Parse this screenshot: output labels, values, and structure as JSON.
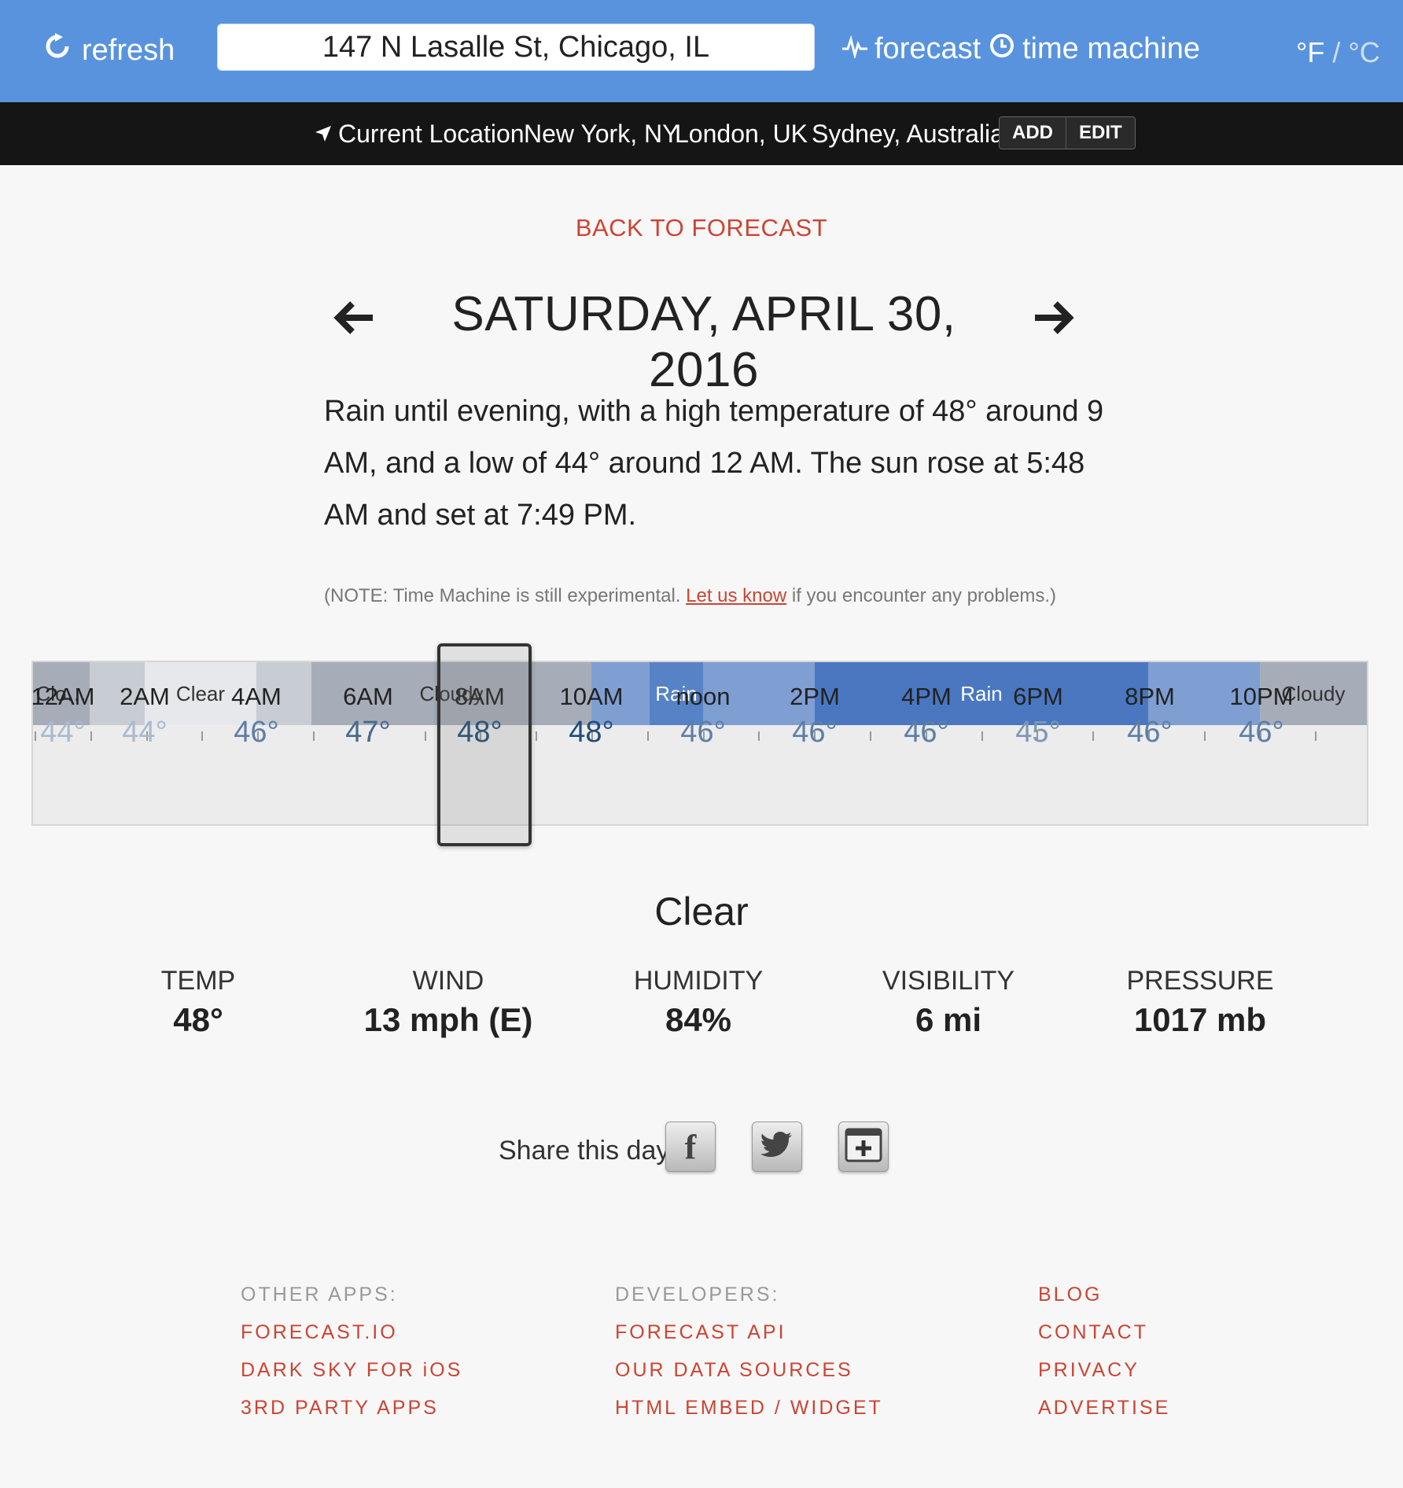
{
  "header": {
    "refresh_label": "refresh",
    "address_value": "147 N Lasalle St, Chicago, IL",
    "forecast_label": "forecast",
    "time_machine_label": "time machine",
    "unit_f": "°F",
    "unit_sep": " / ",
    "unit_c": "°C"
  },
  "locations": {
    "items": [
      "Current Location",
      "New York, NY",
      "London, UK",
      "Sydney, Australia"
    ],
    "add_label": "ADD",
    "edit_label": "EDIT"
  },
  "main": {
    "back_label": "BACK TO FORECAST",
    "date_title": "SATURDAY, APRIL 30, 2016",
    "summary": "Rain until evening, with a high temperature of 48° around 9 AM, and a low of 44° around 12 AM. The sun rose at 5:48 AM and set at 7:49 PM.",
    "note_prefix": "(NOTE: Time Machine is still experimental. ",
    "note_link": "Let us know",
    "note_suffix": " if you encounter any problems.)"
  },
  "timeline": {
    "bands": [
      {
        "label": "Clo…",
        "color": "#a7adb8",
        "text_color": "#333333"
      },
      {
        "label": "",
        "color": "#c8ccd3",
        "text_color": "#333333"
      },
      {
        "label": "Clear",
        "color": "#e7e8eb",
        "text_color": "#333333"
      },
      {
        "label": "",
        "color": "#c8ccd3",
        "text_color": "#333333"
      },
      {
        "label": "Cloudy",
        "color": "#a7adb8",
        "text_color": "#333333"
      },
      {
        "label": "",
        "color": "#7f9fd3",
        "text_color": "#ffffff"
      },
      {
        "label": "Rain",
        "color": "#5882c6",
        "text_color": "#ffffff"
      },
      {
        "label": "",
        "color": "#7f9fd3",
        "text_color": "#ffffff"
      },
      {
        "label": "Rain",
        "color": "#4a77c0",
        "text_color": "#ffffff"
      },
      {
        "label": "",
        "color": "#7f9fd3",
        "text_color": "#ffffff"
      },
      {
        "label": "Cloudy",
        "color": "#a7adb8",
        "text_color": "#333333"
      }
    ],
    "hours": [
      {
        "time": "12AM",
        "temp": "44°",
        "temp_color": "#a9bacd"
      },
      {
        "time": "2AM",
        "temp": "44°",
        "temp_color": "#a9bacd"
      },
      {
        "time": "4AM",
        "temp": "46°",
        "temp_color": "#5d7fa6"
      },
      {
        "time": "6AM",
        "temp": "47°",
        "temp_color": "#46698f"
      },
      {
        "time": "8AM",
        "temp": "48°",
        "temp_color": "#1f4d7a"
      },
      {
        "time": "10AM",
        "temp": "48°",
        "temp_color": "#1f4d7a"
      },
      {
        "time": "noon",
        "temp": "46°",
        "temp_color": "#5d7fa6"
      },
      {
        "time": "2PM",
        "temp": "46°",
        "temp_color": "#5d7fa6"
      },
      {
        "time": "4PM",
        "temp": "46°",
        "temp_color": "#5d7fa6"
      },
      {
        "time": "6PM",
        "temp": "45°",
        "temp_color": "#7d97b6"
      },
      {
        "time": "8PM",
        "temp": "46°",
        "temp_color": "#5d7fa6"
      },
      {
        "time": "10PM",
        "temp": "46°",
        "temp_color": "#5d7fa6"
      }
    ]
  },
  "current": {
    "summary": "Clear",
    "stats": [
      {
        "label": "TEMP",
        "value": "48°"
      },
      {
        "label": "WIND",
        "value": "13 mph (E)"
      },
      {
        "label": "HUMIDITY",
        "value": "84%"
      },
      {
        "label": "VISIBILITY",
        "value": "6 mi"
      },
      {
        "label": "PRESSURE",
        "value": "1017 mb"
      }
    ]
  },
  "share": {
    "label": "Share this day:",
    "facebook_glyph": "f"
  },
  "footer": {
    "col1": {
      "heading": "OTHER APPS:",
      "links": [
        "FORECAST.IO",
        "DARK SKY FOR iOS",
        "3RD PARTY APPS"
      ]
    },
    "col2": {
      "heading": "DEVELOPERS:",
      "links": [
        "FORECAST API",
        "OUR DATA SOURCES",
        "HTML EMBED / WIDGET"
      ]
    },
    "col3": {
      "links": [
        "BLOG",
        "CONTACT",
        "PRIVACY",
        "ADVERTISE"
      ]
    }
  }
}
